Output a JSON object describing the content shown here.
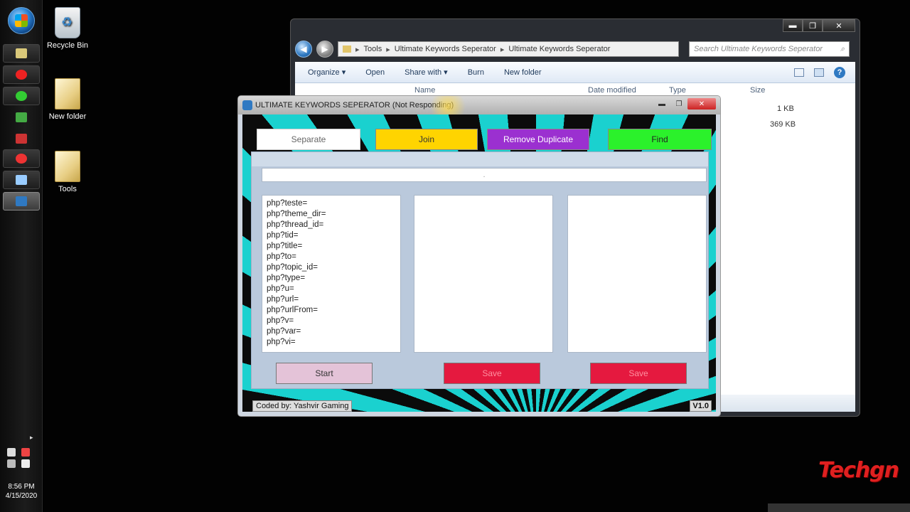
{
  "desktop": {
    "icons": [
      {
        "label": "Recycle Bin"
      },
      {
        "label": "New folder"
      },
      {
        "label": "Tools"
      }
    ]
  },
  "taskbar": {
    "clock_time": "8:56 PM",
    "clock_date": "4/15/2020"
  },
  "explorer": {
    "caption": {
      "minimize": "▬",
      "maximize": "❐",
      "close": "✕"
    },
    "address": {
      "crumbs": [
        "Tools",
        "Ultimate Keywords Seperator",
        "Ultimate Keywords Seperator"
      ]
    },
    "search_placeholder": "Search Ultimate Keywords Seperator",
    "commands": {
      "organize": "Organize ▾",
      "open": "Open",
      "share_with": "Share with ▾",
      "burn": "Burn",
      "new_folder": "New folder"
    },
    "columns": {
      "name": "Name",
      "date_modified": "Date modified",
      "type": "Type",
      "size": "Size"
    },
    "sizes": [
      "1 KB",
      "369 KB"
    ]
  },
  "app": {
    "title": "ULTIMATE KEYWORDS SEPERATOR (Not Responding)",
    "tabs": {
      "separate": "Separate",
      "join": "Join",
      "remove_duplicate": "Remove Duplicate",
      "find": "Find"
    },
    "input_value": ".",
    "keywords": [
      "php?teste=",
      "php?theme_dir=",
      "php?thread_id=",
      "php?tid=",
      "php?title=",
      "php?to=",
      "php?topic_id=",
      "php?type=",
      "php?u=",
      "php?url=",
      "php?urlFrom=",
      "php?v=",
      "php?var=",
      "php?vi="
    ],
    "buttons": {
      "start": "Start",
      "save_1": "Save",
      "save_2": "Save"
    },
    "credit": "Coded by: Yashvir Gaming",
    "version": "V1.0"
  },
  "watermark": "Techgn"
}
